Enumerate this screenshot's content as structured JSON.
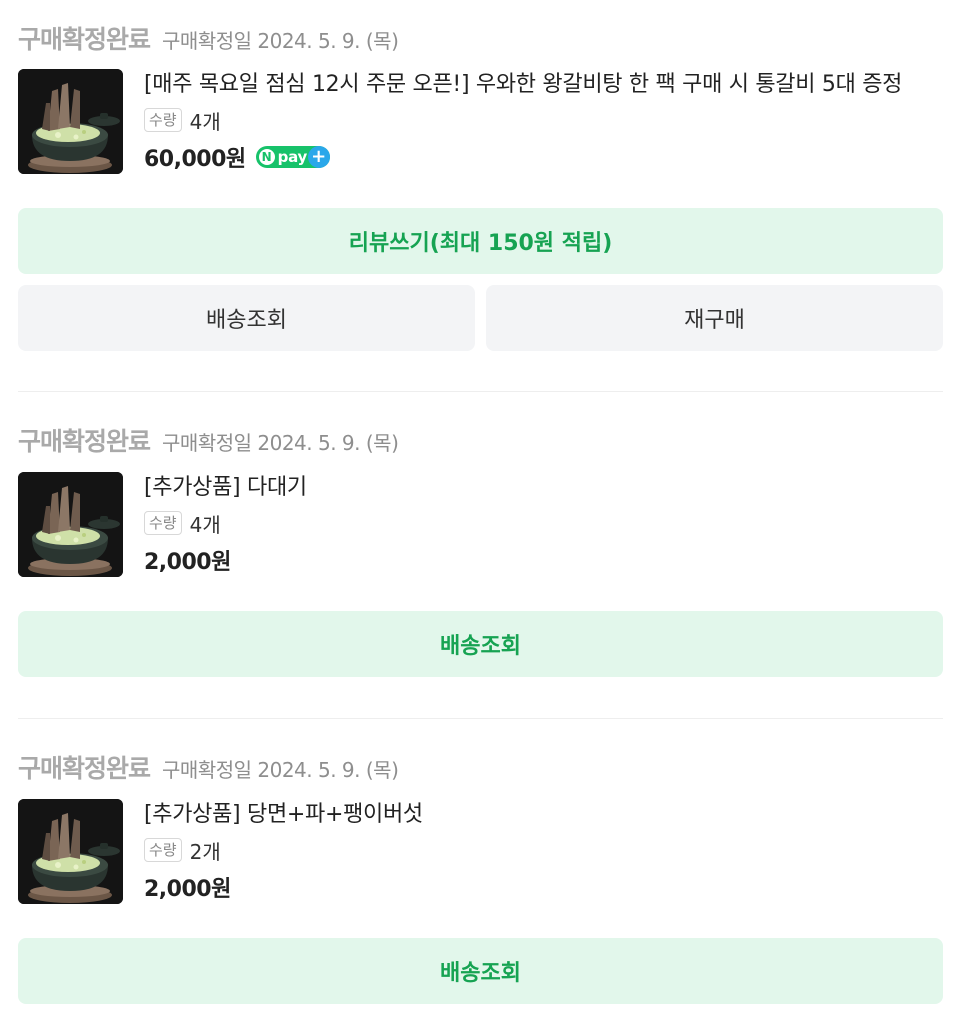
{
  "orders": [
    {
      "status": "구매확정완료",
      "confirm_date": "구매확정일 2024. 5. 9. (목)",
      "title": "[매주 목요일 점심 12시 주문 오픈!] 우와한 왕갈비탕 한 팩 구매 시 통갈비 5대 증정",
      "qty_label": "수량",
      "qty": "4개",
      "price": "60,000원",
      "npay": {
        "n": "N",
        "pay": "pay",
        "plus": "+"
      },
      "buttons": {
        "review": "리뷰쓰기(최대 150원 적립)",
        "tracking": "배송조회",
        "rebuy": "재구매"
      }
    },
    {
      "status": "구매확정완료",
      "confirm_date": "구매확정일 2024. 5. 9. (목)",
      "title": "[추가상품] 다대기",
      "qty_label": "수량",
      "qty": "4개",
      "price": "2,000원",
      "buttons": {
        "tracking": "배송조회"
      }
    },
    {
      "status": "구매확정완료",
      "confirm_date": "구매확정일 2024. 5. 9. (목)",
      "title": "[추가상품] 당면+파+팽이버섯",
      "qty_label": "수량",
      "qty": "2개",
      "price": "2,000원",
      "buttons": {
        "tracking": "배송조회"
      }
    }
  ],
  "colors": {
    "primary_green": "#16a352",
    "primary_bg": "#e2f7eb",
    "gray_btn_bg": "#f3f4f6",
    "npay_green": "#17c26a",
    "npay_blue": "#2aa7ea",
    "status_gray": "#a9a9a9"
  }
}
